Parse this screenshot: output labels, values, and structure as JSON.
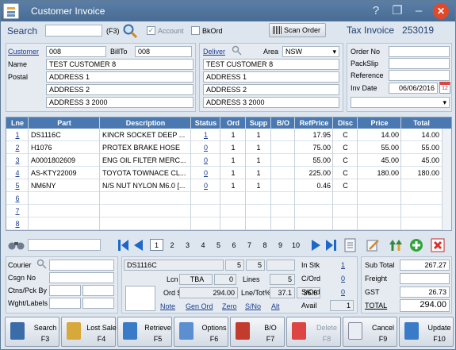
{
  "window": {
    "title": "Customer Invoice",
    "help": "?",
    "restore": "❐",
    "minimize": "–",
    "close": "✕"
  },
  "top": {
    "search_label": "Search",
    "search_hint": "(F3)",
    "account_label": "Account",
    "bkord_label": "BkOrd",
    "scan_label": "Scan Order",
    "title": "Tax Invoice",
    "number": "253019"
  },
  "customer": {
    "customer_label": "Customer",
    "customer_value": "008",
    "billto_label": "BillTo",
    "billto_value": "008",
    "name_label": "Name",
    "name_value": "TEST CUSTOMER 8",
    "postal_label": "Postal",
    "addr1": "ADDRESS 1",
    "addr2": "ADDRESS 2",
    "addr3": "ADDRESS 3 2000"
  },
  "deliver": {
    "deliver_label": "Deliver",
    "area_label": "Area",
    "area_value": "NSW",
    "name_value": "TEST CUSTOMER 8",
    "addr1": "ADDRESS 1",
    "addr2": "ADDRESS 2",
    "addr3": "ADDRESS 3 2000"
  },
  "order": {
    "orderno_label": "Order No",
    "orderno_value": "",
    "packslip_label": "PackSlip",
    "packslip_value": "",
    "reference_label": "Reference",
    "reference_value": "",
    "invdate_label": "Inv Date",
    "invdate_value": "06/06/2016",
    "calendar_day": "12"
  },
  "grid": {
    "headers": [
      "Lne",
      "Part",
      "Description",
      "Status",
      "Ord",
      "Supp",
      "B/O",
      "RefPrice",
      "Disc",
      "Price",
      "Total"
    ],
    "rows": [
      [
        "1",
        "DS1116C",
        "KINCR SOCKET DEEP ...",
        "1",
        "1",
        "1",
        "",
        "17.95",
        "C",
        "14.00",
        "14.00"
      ],
      [
        "2",
        "H1076",
        "PROTEX BRAKE HOSE",
        "0",
        "1",
        "1",
        "",
        "75.00",
        "C",
        "55.00",
        "55.00"
      ],
      [
        "3",
        "A0001802609",
        "ENG OIL FILTER MERC...",
        "0",
        "1",
        "1",
        "",
        "55.00",
        "C",
        "45.00",
        "45.00"
      ],
      [
        "4",
        "AS-KTY22009",
        "TOYOTA TOWNACE CL...",
        "0",
        "1",
        "1",
        "",
        "225.00",
        "C",
        "180.00",
        "180.00"
      ],
      [
        "5",
        "NM6NY",
        "N/S NUT NYLON M6.0 [...",
        "0",
        "1",
        "1",
        "",
        "0.46",
        "C",
        "",
        ""
      ],
      [
        "6",
        "",
        "",
        "",
        "",
        "",
        "",
        "",
        "",
        "",
        ""
      ],
      [
        "7",
        "",
        "",
        "",
        "",
        "",
        "",
        "",
        "",
        "",
        ""
      ],
      [
        "8",
        "",
        "",
        "",
        "",
        "",
        "",
        "",
        "",
        "",
        ""
      ]
    ]
  },
  "pager": {
    "pages": [
      "1",
      "2",
      "3",
      "4",
      "5",
      "6",
      "7",
      "8",
      "9",
      "10"
    ]
  },
  "shipping": {
    "courier_label": "Courier",
    "csgn_label": "Csgn No",
    "ctns_label": "Ctns/Pck By",
    "wght_label": "Wght/Labels"
  },
  "detail": {
    "part": "DS1116C",
    "v1": "5",
    "v2": "5",
    "lcn_label": "Lcn",
    "lcn_value": "TBA",
    "lcn_num": "0",
    "lines_label": "Lines",
    "lines_value": "5",
    "ord_label": "Ord $",
    "ord_value": "294.00",
    "lnetot_label": "Lne/Tot%",
    "lne_value": "37.1",
    "tot_value": "36.6",
    "links": [
      "Note",
      "Gen Ord",
      "Zero",
      "S/No",
      "Alt"
    ],
    "instk_label": "In Stk",
    "instk_value": "1",
    "cord_label": "C/Ord",
    "cord_value": "0",
    "sord_label": "S/Ord",
    "sord_value": "0",
    "avail_label": "Avail",
    "avail_value": "1"
  },
  "totals": {
    "subtotal_label": "Sub Total",
    "subtotal_value": "267.27",
    "freight_label": "Freight",
    "freight_value": "",
    "gst_label": "GST",
    "gst_value": "26.73",
    "total_label": "TOTAL",
    "total_value": "294.00"
  },
  "footer": [
    {
      "label": "Search",
      "key": "F3"
    },
    {
      "label": "Lost Sale",
      "key": "F4"
    },
    {
      "label": "Retrieve",
      "key": "F5"
    },
    {
      "label": "Options",
      "key": "F6"
    },
    {
      "label": "B/O",
      "key": "F7"
    },
    {
      "label": "Delete",
      "key": "F8"
    },
    {
      "label": "Cancel",
      "key": "F9"
    },
    {
      "label": "Update",
      "key": "F10"
    }
  ],
  "colors": {
    "header_blue": "#4a78b0",
    "title_bar": "#5a7ea5",
    "close_red": "#e2492b",
    "link_blue": "#1a3d8f"
  }
}
